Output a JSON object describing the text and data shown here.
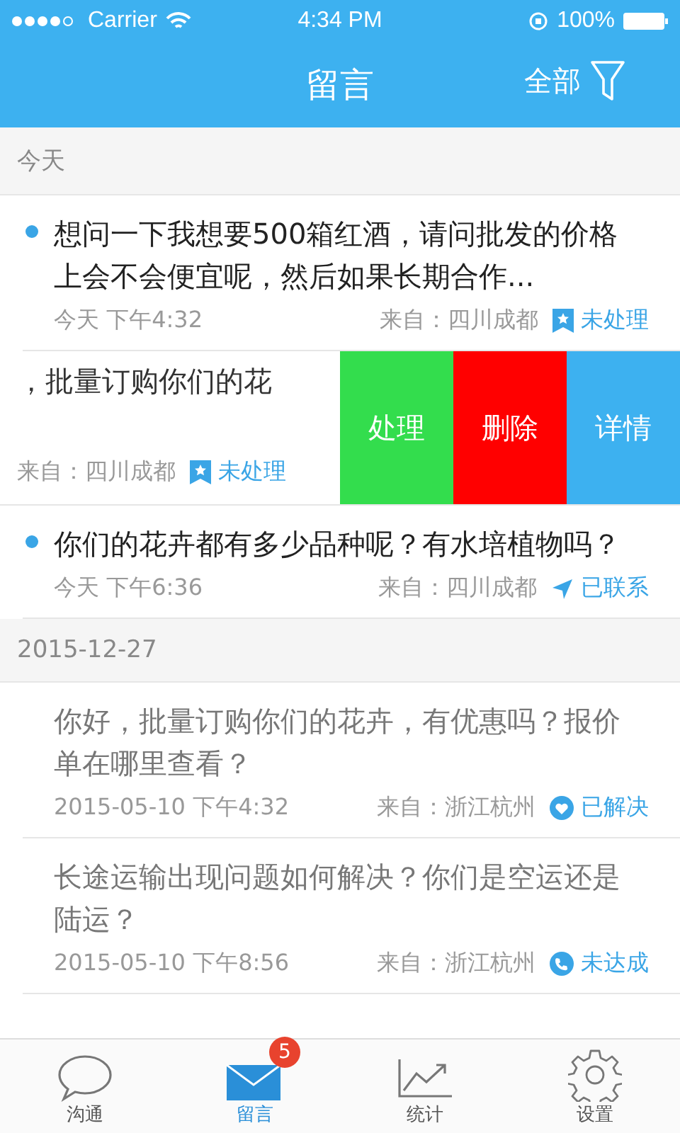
{
  "status_bar": {
    "carrier": "Carrier",
    "time": "4:34 PM",
    "battery": "100%"
  },
  "header": {
    "title": "留言",
    "filter": "全部"
  },
  "sections": [
    {
      "date": "今天",
      "items": [
        {
          "kind": "normal",
          "unread": true,
          "text": "想问一下我想要500箱红酒，请问批发的价格上会不会便宜呢，然后如果长期合作...",
          "time": "今天 下午4:32",
          "source": "来自：四川成都",
          "status": {
            "label": "未处理",
            "kind": "pending"
          }
        },
        {
          "kind": "swiped",
          "unread": false,
          "text": "，批量订购你们的花",
          "source": "来自：四川成都",
          "status": {
            "label": "未处理",
            "kind": "pending"
          },
          "actions": [
            {
              "label": "处理",
              "color": "#33dd4d"
            },
            {
              "label": "删除",
              "color": "#ff0000"
            },
            {
              "label": "详情",
              "color": "#3db1f0"
            }
          ]
        },
        {
          "kind": "normal",
          "unread": true,
          "text": "你们的花卉都有多少品种呢？有水培植物吗？",
          "time": "今天 下午6:36",
          "source": "来自：四川成都",
          "status": {
            "label": "已联系",
            "kind": "contacted"
          }
        }
      ]
    },
    {
      "date": "2015-12-27",
      "items": [
        {
          "kind": "normal",
          "unread": false,
          "text": "你好，批量订购你们的花卉，有优惠吗？报价单在哪里查看？",
          "time": "2015-05-10 下午4:32",
          "source": "来自：浙江杭州",
          "status": {
            "label": "已解决",
            "kind": "resolved"
          }
        },
        {
          "kind": "normal",
          "unread": false,
          "text": "长途运输出现问题如何解决？你们是空运还是陆运？",
          "time": "2015-05-10 下午8:56",
          "source": "来自：浙江杭州",
          "status": {
            "label": "未达成",
            "kind": "failed"
          }
        }
      ]
    }
  ],
  "tabs": [
    {
      "label": "沟通",
      "selected": false
    },
    {
      "label": "留言",
      "selected": true,
      "badge": "5"
    },
    {
      "label": "统计",
      "selected": false
    },
    {
      "label": "设置",
      "selected": false
    }
  ]
}
